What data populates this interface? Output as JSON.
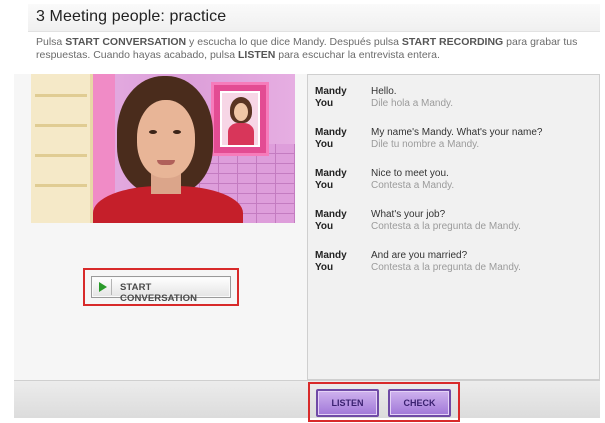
{
  "header": {
    "title": "3  Meeting people: practice"
  },
  "instructions": {
    "p1": "Pulsa ",
    "b1": "START CONVERSATION",
    "p2": " y escucha lo que dice Mandy. Después pulsa ",
    "b2": "START RECORDING",
    "p3": " para grabar tus respuestas. Cuando hayas acabado, pulsa ",
    "b3": "LISTEN",
    "p4": " para escuchar la entrevista entera."
  },
  "player": {
    "start_label": "START CONVERSATION"
  },
  "dialogue": [
    {
      "speaker1": "Mandy",
      "line1": "Hello.",
      "speaker2": "You",
      "line2": "Dile hola a Mandy."
    },
    {
      "speaker1": "Mandy",
      "line1": "My name's Mandy. What's your name?",
      "speaker2": "You",
      "line2": "Dile tu nombre a Mandy."
    },
    {
      "speaker1": "Mandy",
      "line1": "Nice to meet you.",
      "speaker2": "You",
      "line2": "Contesta a Mandy."
    },
    {
      "speaker1": "Mandy",
      "line1": "What's your job?",
      "speaker2": "You",
      "line2": "Contesta a la pregunta de Mandy."
    },
    {
      "speaker1": "Mandy",
      "line1": "And are you married?",
      "speaker2": "You",
      "line2": "Contesta a la pregunta de Mandy."
    }
  ],
  "footer": {
    "listen_label": "LISTEN",
    "check_label": "CHECK"
  },
  "icons": {
    "start": "play-icon"
  },
  "colors": {
    "highlight": "#d82a2a",
    "button_purple": "#a077d8",
    "play_green": "#2a9a2a"
  }
}
